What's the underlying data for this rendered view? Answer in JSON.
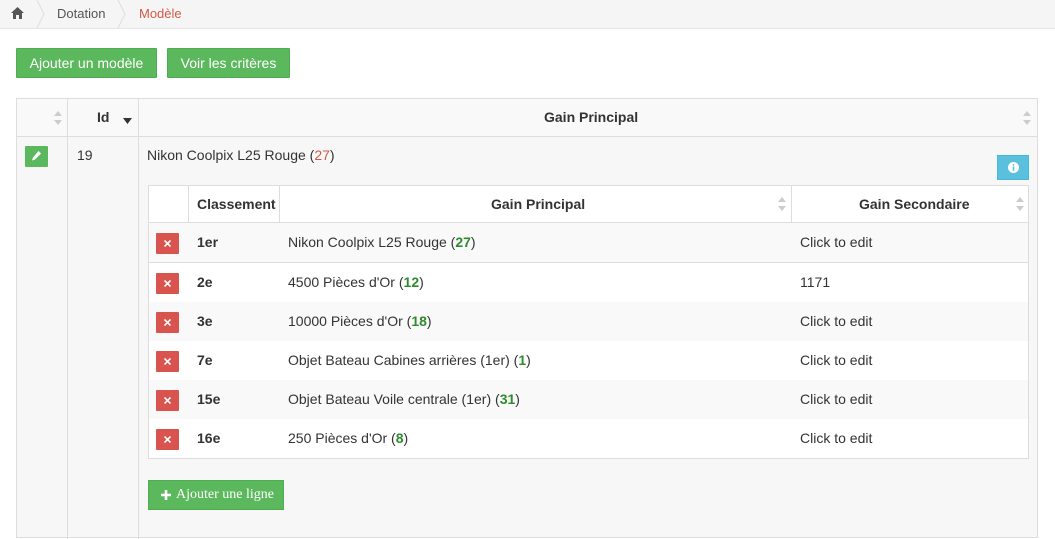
{
  "breadcrumb": {
    "home_icon": "home-icon",
    "items": [
      "Dotation",
      "Modèle"
    ]
  },
  "toolbar": {
    "add_model_label": "Ajouter un modèle",
    "criteria_label": "Voir les critères"
  },
  "outer_table": {
    "columns": [
      "",
      "Id",
      "Gain Principal"
    ],
    "sort": {
      "column": "Id",
      "direction": "desc"
    },
    "row": {
      "id": "19",
      "title": "Nikon Coolpix L25 Rouge",
      "title_count": "27",
      "edit_icon": "pencil-icon",
      "info_icon": "info-icon"
    }
  },
  "inner_table": {
    "columns": [
      "",
      "Classement",
      "Gain Principal",
      "Gain Secondaire"
    ],
    "rows": [
      {
        "rank": "1er",
        "gain": "Nikon Coolpix L25 Rouge",
        "count": "27",
        "secondary": "Click to edit"
      },
      {
        "rank": "2e",
        "gain": "4500 Pièces d'Or",
        "count": "12",
        "secondary": "1171"
      },
      {
        "rank": "3e",
        "gain": "10000 Pièces d'Or",
        "count": "18",
        "secondary": "Click to edit"
      },
      {
        "rank": "7e",
        "gain": "Objet Bateau Cabines arrières (1er)",
        "count": "1",
        "secondary": "Click to edit"
      },
      {
        "rank": "15e",
        "gain": "Objet Bateau Voile centrale (1er)",
        "count": "31",
        "secondary": "Click to edit"
      },
      {
        "rank": "16e",
        "gain": "250 Pièces d'Or",
        "count": "8",
        "secondary": "Click to edit"
      }
    ]
  },
  "add_line_label": "Ajouter une ligne",
  "colors": {
    "green": "#5cb85c",
    "red": "#d9534f",
    "info": "#5bc0de",
    "accent_text": "#d15b47",
    "count_green": "#2e8b2e"
  }
}
